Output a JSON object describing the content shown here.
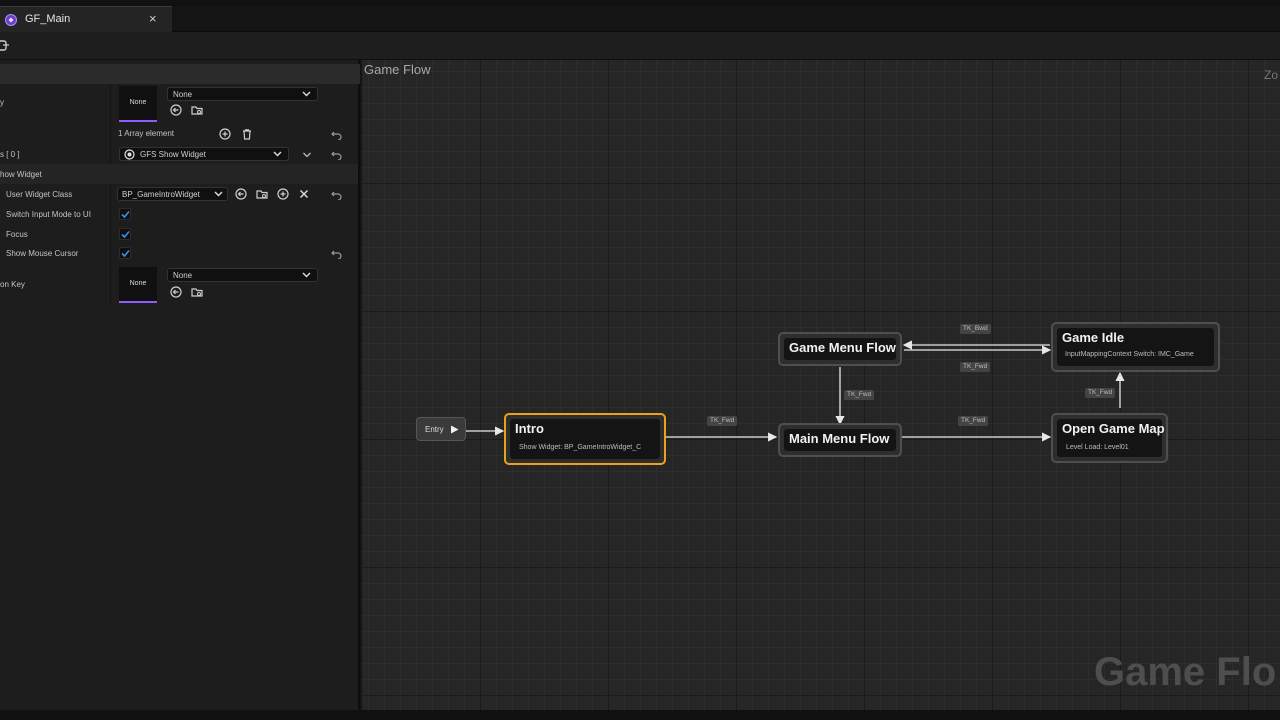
{
  "tab": {
    "title": "GF_Main",
    "close": "×"
  },
  "details": {
    "row1": {
      "label": "y",
      "thumb": "None",
      "dropdown": "None"
    },
    "array_count": "1 Array element",
    "array_item": {
      "label": "s [ 0 ]",
      "value": "GFS Show Widget"
    },
    "section": "how Widget",
    "user_widget_class": {
      "label": "User Widget Class",
      "value": "BP_GameIntroWidget"
    },
    "switch_input": {
      "label": "Switch Input Mode to UI",
      "checked": true
    },
    "focus": {
      "label": "Focus",
      "checked": true
    },
    "show_cursor": {
      "label": "Show Mouse Cursor",
      "checked": true
    },
    "key_row": {
      "label": "on Key",
      "thumb": "None",
      "dropdown": "None"
    }
  },
  "graph": {
    "title": "Game Flow",
    "zoom_label": "Zo",
    "watermark": "Game Flo",
    "entry_label": "Entry",
    "nodes": {
      "intro": {
        "title": "Intro",
        "sub": "Show Widget: BP_GameIntroWidget_C"
      },
      "main_menu": {
        "title": "Main Menu Flow"
      },
      "game_menu": {
        "title": "Game Menu Flow"
      },
      "game_idle": {
        "title": "Game Idle",
        "sub": "InputMappingContext Switch: IMC_Game"
      },
      "open_map": {
        "title": "Open Game Map",
        "sub": "Level Load: Level01"
      }
    },
    "edge_labels": {
      "intro_to_main": "TK_Fwd",
      "main_to_open": "TK_Fwd",
      "menu_to_main": "TK_Fwd",
      "open_to_idle": "TK_Fwd",
      "idle_to_menu": "TK_Bwd",
      "menu_to_idle": "TK_Fwd"
    }
  },
  "colors": {
    "accent_purple": "#8d5cff",
    "selection_orange": "#e8a21c",
    "checkbox_blue": "#3a8ee6"
  }
}
